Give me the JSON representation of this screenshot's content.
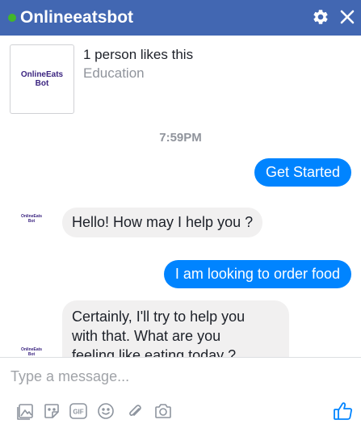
{
  "header": {
    "title": "Onlineeatsbot",
    "settings_icon": "gear-icon",
    "close_icon": "close-icon",
    "background": "#4267b2",
    "status_color": "#42b72a"
  },
  "page_info": {
    "logo_line1": "OnlineEats",
    "logo_line2": "Bot",
    "likes": "1 person likes this",
    "category": "Education"
  },
  "conversation": {
    "timestamp": "7:59PM",
    "avatar_line1": "OnlineEats",
    "avatar_line2": "Bot",
    "messages": [
      {
        "from": "user",
        "text": "Get Started"
      },
      {
        "from": "bot",
        "text": "Hello! How may I help you ?"
      },
      {
        "from": "user",
        "text": "I am looking to order food"
      },
      {
        "from": "bot",
        "lines": [
          "Certainly, I'll try to help you",
          "with that. What are you",
          "feeling like eating today ?"
        ]
      }
    ]
  },
  "composer": {
    "placeholder": "Type a message...",
    "tools": [
      "image-icon",
      "sticker-icon",
      "gif-icon",
      "emoji-icon",
      "attachment-icon",
      "camera-icon"
    ],
    "gif_label": "GIF",
    "like_icon": "thumbs-up-icon"
  },
  "colors": {
    "user_bubble": "#0084ff",
    "bot_bubble": "#f1f0f0",
    "toolbar_icon": "#8d949e",
    "like_icon": "#0084ff"
  }
}
